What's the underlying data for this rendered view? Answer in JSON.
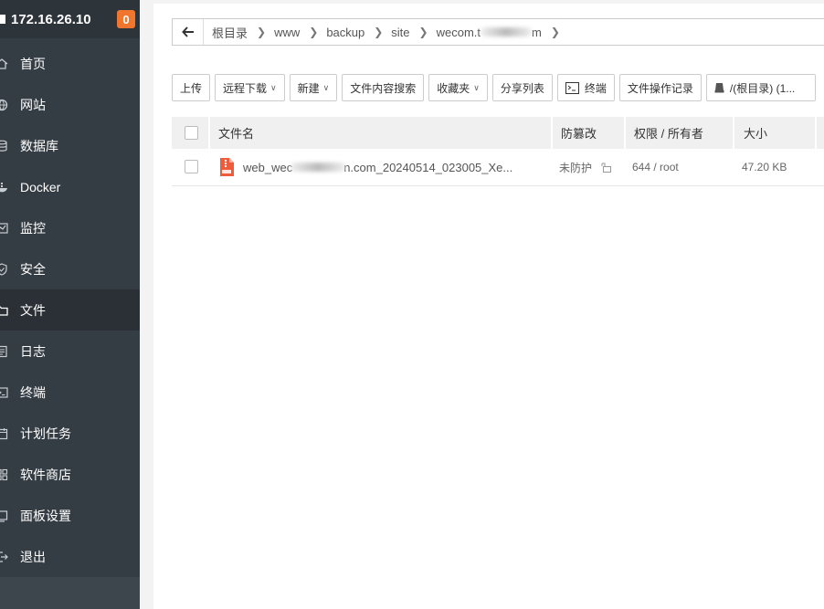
{
  "sidebar": {
    "server_ip": "172.16.26.10",
    "badge_count": "0",
    "items": [
      {
        "label": "首页",
        "icon": "home-icon"
      },
      {
        "label": "网站",
        "icon": "globe-icon"
      },
      {
        "label": "数据库",
        "icon": "database-icon"
      },
      {
        "label": "Docker",
        "icon": "docker-icon"
      },
      {
        "label": "监控",
        "icon": "monitor-icon"
      },
      {
        "label": "安全",
        "icon": "shield-icon"
      },
      {
        "label": "文件",
        "icon": "folder-icon",
        "active": true
      },
      {
        "label": "日志",
        "icon": "log-icon"
      },
      {
        "label": "终端",
        "icon": "terminal-icon"
      },
      {
        "label": "计划任务",
        "icon": "calendar-icon"
      },
      {
        "label": "软件商店",
        "icon": "apps-icon"
      },
      {
        "label": "面板设置",
        "icon": "settings-icon"
      },
      {
        "label": "退出",
        "icon": "logout-icon"
      }
    ]
  },
  "breadcrumb": {
    "items": [
      "根目录",
      "www",
      "backup",
      "site"
    ],
    "last_prefix": "wecom.t",
    "last_suffix": "m"
  },
  "toolbar": {
    "upload": "上传",
    "remote_download": "远程下载",
    "new": "新建",
    "content_search": "文件内容搜索",
    "favorites": "收藏夹",
    "share_list": "分享列表",
    "terminal": "终端",
    "operation_log": "文件操作记录",
    "path_display": "/(根目录) (1..."
  },
  "table": {
    "headers": {
      "name": "文件名",
      "tamper": "防篡改",
      "permission": "权限 / 所有者",
      "size": "大小"
    },
    "rows": [
      {
        "name_prefix": "web_wec",
        "name_suffix": "n.com_20240514_023005_Xe...",
        "tamper": "未防护",
        "permission": "644 / root",
        "size": "47.20 KB"
      }
    ]
  },
  "colors": {
    "sidebar_bg": "#353d44",
    "badge": "#f0762e",
    "file_icon": "#ef5b3b"
  }
}
